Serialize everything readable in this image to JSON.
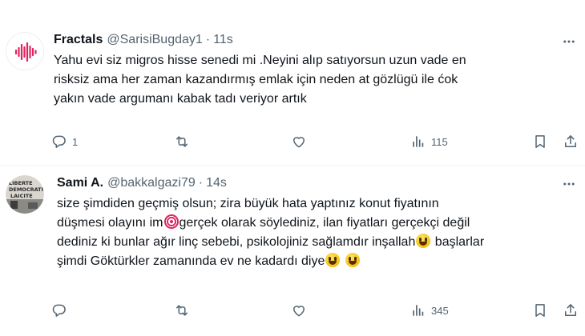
{
  "tweets": [
    {
      "name": "Fractals",
      "handle": "@SarisiBugday1",
      "separator": "·",
      "time": "11s",
      "text": "Yahu evi siz migros hisse senedi mi .Neyini alıp satıyorsun uzun vade en\nrisksiz  ama her zaman kazandırmış emlak için neden at gözlügü ile ćok\nyakın vade argumanı kabak tadı veriyor artık",
      "reply_count": "1",
      "retweet_count": "",
      "like_count": "",
      "view_count": "115",
      "avatar": {
        "icon": "audio-wave-icon",
        "bg": "#ffffff",
        "fg": "#e0245e"
      }
    },
    {
      "name": "Sami A.",
      "handle": "@bakkalgazi79",
      "separator": "·",
      "time": "14s",
      "text_parts": {
        "p1": "size şimdiden geçmiş olsun; zira büyük hata yaptınız konut fiyatının\ndüşmesi olayını im",
        "p2": "gerçek olarak söylediniz, ilan fiyatları gerçekçi değil\ndediniz ki bunlar ağır linç sebebi, psikolojiniz sağlamdır inşallah",
        "p3": " başlarlar\nşimdi Göktürkler zamanında ev ne kadardı diye"
      },
      "reply_count": "",
      "retweet_count": "",
      "like_count": "",
      "view_count": "345",
      "avatar": {
        "icon": "graffiti-wall-icon",
        "text": "LIBERTE DEMOCRATIE LAICITE"
      }
    }
  ],
  "colors": {
    "text": "#0f1419",
    "secondary": "#536471",
    "border": "#eff3f4"
  }
}
